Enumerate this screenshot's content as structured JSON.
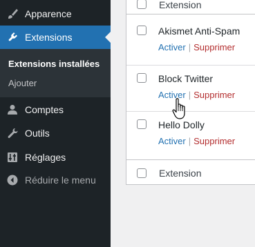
{
  "sidebar": {
    "items": [
      {
        "label": "Apparence",
        "icon": "brush-icon"
      },
      {
        "label": "Extensions",
        "icon": "plugin-icon",
        "active": true
      },
      {
        "label": "Comptes",
        "icon": "users-icon"
      },
      {
        "label": "Outils",
        "icon": "wrench-icon"
      },
      {
        "label": "Réglages",
        "icon": "settings-icon"
      },
      {
        "label": "Réduire le menu",
        "icon": "collapse-icon"
      }
    ],
    "submenu": [
      {
        "label": "Extensions installées",
        "current": true
      },
      {
        "label": "Ajouter"
      }
    ]
  },
  "table": {
    "column_header": "Extension",
    "column_footer": "Extension",
    "plugins": [
      {
        "name": "Akismet Anti-Spam",
        "activate": "Activer",
        "delete": "Supprimer"
      },
      {
        "name": "Block Twitter",
        "activate": "Activer",
        "delete": "Supprimer"
      },
      {
        "name": "Hello Dolly",
        "activate": "Activer",
        "delete": "Supprimer"
      }
    ],
    "separator": "|"
  },
  "colors": {
    "sidebar_bg": "#1d2327",
    "submenu_bg": "#2c3338",
    "accent": "#2271b1",
    "delete": "#b32d2e"
  }
}
